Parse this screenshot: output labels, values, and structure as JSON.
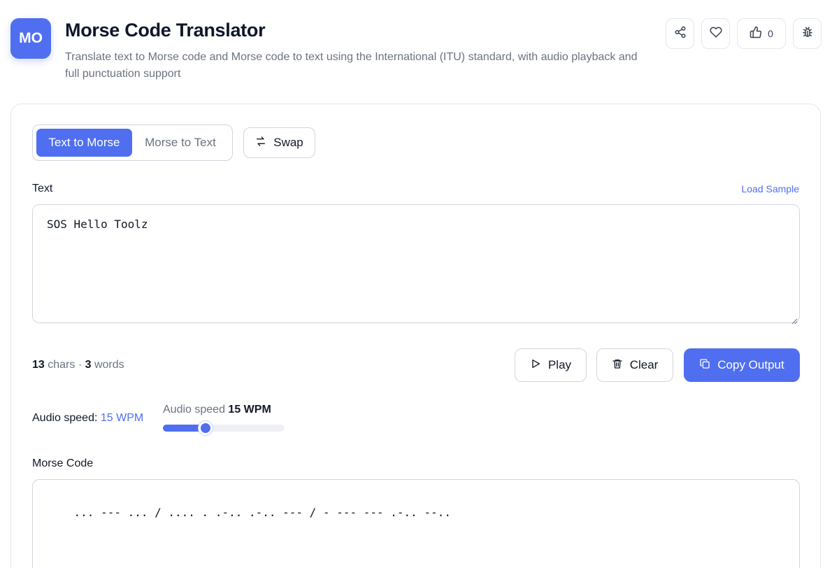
{
  "app": {
    "logo_text": "MO",
    "title": "Morse Code Translator",
    "subtitle": "Translate text to Morse code and Morse code to text using the International (ITU) standard, with audio playback and full punctuation support",
    "accent_color": "#4f6ff0"
  },
  "header_actions": {
    "share_icon": "share-icon",
    "favorite_icon": "heart-icon",
    "like_icon": "thumbs-up-icon",
    "like_count": "0",
    "bug_icon": "bug-icon"
  },
  "mode": {
    "options": [
      "Text to Morse",
      "Morse to Text"
    ],
    "selected": "Text to Morse",
    "swap_label": "Swap"
  },
  "input": {
    "label": "Text",
    "load_sample": "Load Sample",
    "value": "SOS Hello Toolz"
  },
  "stats": {
    "chars": "13",
    "chars_label": "chars",
    "separator": "·",
    "words": "3",
    "words_label": "words"
  },
  "actions": {
    "play": "Play",
    "clear": "Clear",
    "copy": "Copy Output"
  },
  "audio": {
    "label": "Audio speed:",
    "value": "15 WPM",
    "slider_caption": "Audio speed",
    "slider_value": "15 WPM",
    "slider_fraction": 0.35
  },
  "output": {
    "label": "Morse Code",
    "value": "... --- ... / .... . .-.. .-.. --- / - --- --- .-.. --.."
  }
}
